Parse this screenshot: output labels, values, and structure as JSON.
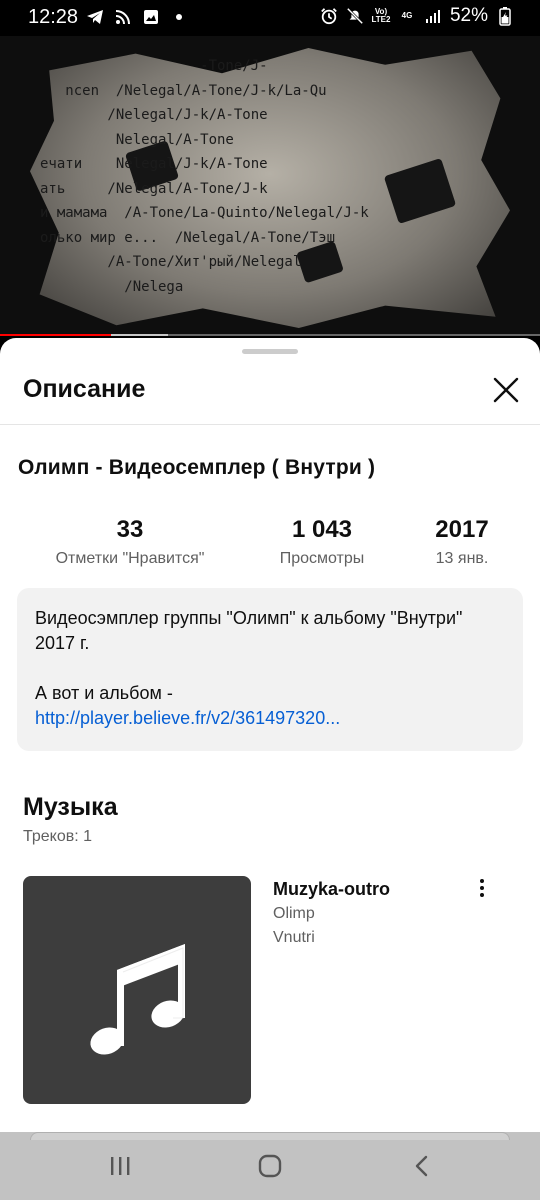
{
  "status_bar": {
    "time": "12:28",
    "network_label": "Vo) LTE2",
    "network_type": "4G",
    "battery": "52%",
    "icons": [
      "telegram-icon",
      "rss-icon",
      "image-icon",
      "dot-icon",
      "alarm-icon",
      "mute-icon",
      "signal-icon",
      "battery-icon"
    ]
  },
  "video": {
    "frame_text": [
      "                   -Tone/J-",
      "   ncen  /Nelegal/A-Tone/J-k/La-Qu",
      "        /Nelegal/J-k/A-Tone",
      "         Nelegal/A-Tone",
      "ечати    Nelegal/J-k/A-Tone",
      "ать     /Nelegal/A-Tone/J-k",
      "и мамама  /A-Tone/La-Quinto/Nelegal/J-k",
      "олько мир е...  /Nelegal/A-Tone/Тэш",
      "        /A-Tone/Хит'рый/Nelegal",
      "          /Nelega"
    ],
    "progress_fraction": 0.205,
    "buffer_fraction": 0.311,
    "progress_color": "#ff0000"
  },
  "sheet": {
    "title": "Описание",
    "close_icon": "close-icon"
  },
  "video_info": {
    "title": "Олимп - Видеосемплер ( Внутри )",
    "stats": [
      {
        "value": "33",
        "label": "Отметки \"Нравится\""
      },
      {
        "value": "1 043",
        "label": "Просмотры"
      },
      {
        "value": "2017",
        "label": "13 янв."
      }
    ]
  },
  "description": {
    "line1": "Видеосэмплер группы \"Олимп\" к альбому \"Внутри\" 2017 г.",
    "line2": "А вот и альбом -",
    "link": "http://player.believe.fr/v2/361497320..."
  },
  "music": {
    "title": "Музыка",
    "count": "Треков: 1",
    "track": {
      "name": "Muzyka-outro",
      "artist": "Olimp",
      "album": "Vnutri",
      "art_icon": "music-note-icon"
    }
  },
  "nav": {
    "icons": [
      "recent-apps-icon",
      "home-icon",
      "back-icon"
    ]
  }
}
